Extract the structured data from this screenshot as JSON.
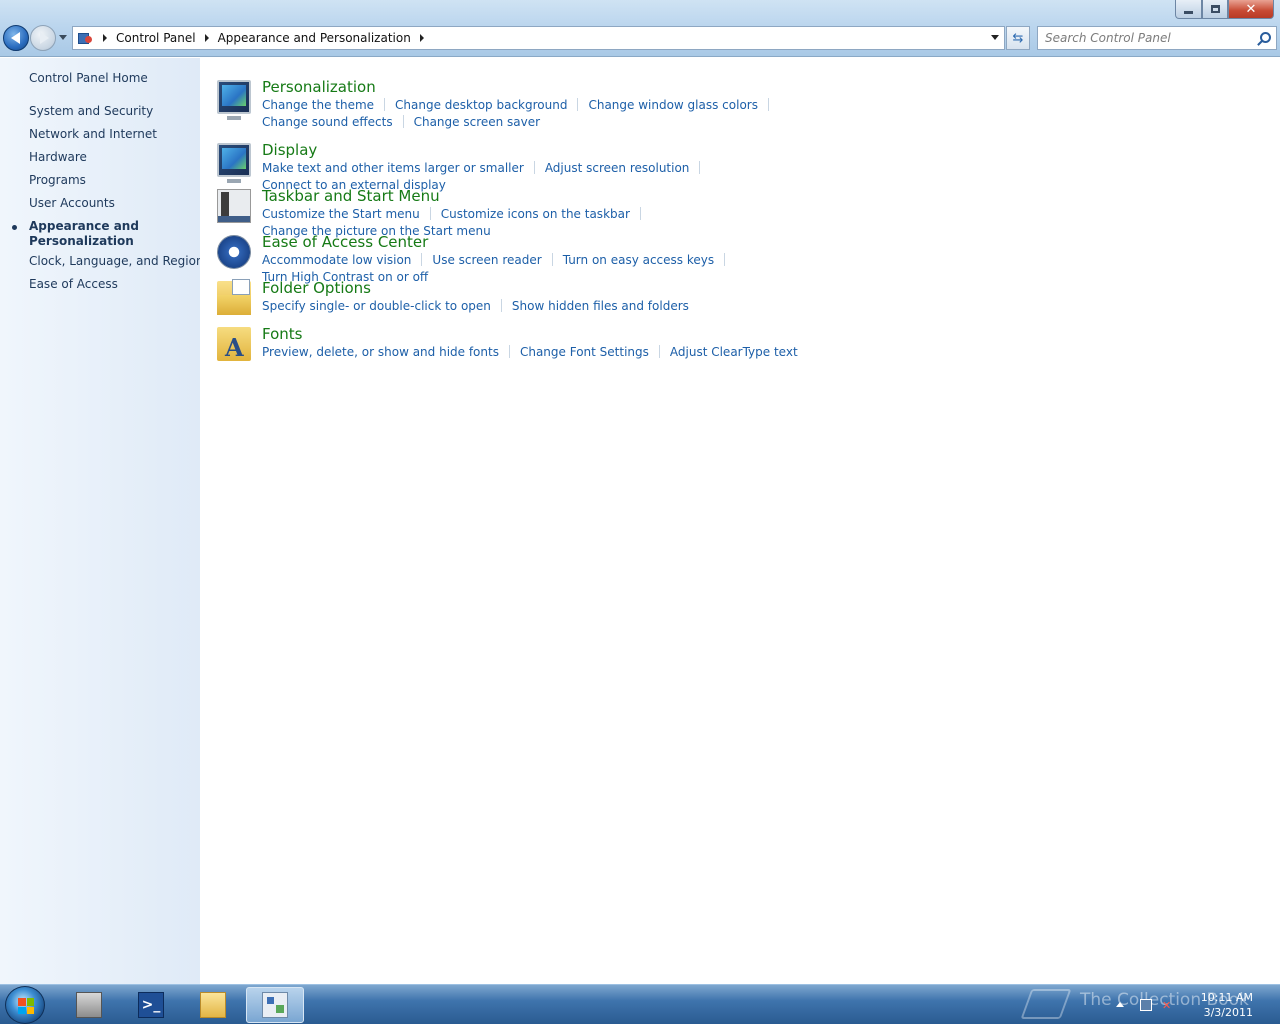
{
  "window": {
    "controls": {
      "minimize": "–",
      "maximize": "□",
      "close": "✕"
    }
  },
  "address": {
    "crumbs": [
      "Control Panel",
      "Appearance and Personalization"
    ]
  },
  "search": {
    "placeholder": "Search Control Panel",
    "value": ""
  },
  "sidebar": {
    "home": "Control Panel Home",
    "items": [
      {
        "label": "System and Security",
        "active": false
      },
      {
        "label": "Network and Internet",
        "active": false
      },
      {
        "label": "Hardware",
        "active": false
      },
      {
        "label": "Programs",
        "active": false
      },
      {
        "label": "User Accounts",
        "active": false
      },
      {
        "label": "Appearance and Personalization",
        "active": true
      },
      {
        "label": "Clock, Language, and Region",
        "active": false
      },
      {
        "label": "Ease of Access",
        "active": false
      }
    ]
  },
  "categories": [
    {
      "title": "Personalization",
      "icon": "personalization-icon",
      "links": [
        "Change the theme",
        "Change desktop background",
        "Change window glass colors",
        "Change sound effects",
        "Change screen saver"
      ]
    },
    {
      "title": "Display",
      "icon": "display-icon",
      "links": [
        "Make text and other items larger or smaller",
        "Adjust screen resolution",
        "Connect to an external display"
      ]
    },
    {
      "title": "Taskbar and Start Menu",
      "icon": "taskbar-start-menu-icon",
      "links": [
        "Customize the Start menu",
        "Customize icons on the taskbar",
        "Change the picture on the Start menu"
      ]
    },
    {
      "title": "Ease of Access Center",
      "icon": "ease-of-access-icon",
      "links": [
        "Accommodate low vision",
        "Use screen reader",
        "Turn on easy access keys",
        "Turn High Contrast on or off"
      ]
    },
    {
      "title": "Folder Options",
      "icon": "folder-options-icon",
      "links": [
        "Specify single- or double-click to open",
        "Show hidden files and folders"
      ]
    },
    {
      "title": "Fonts",
      "icon": "fonts-icon",
      "links": [
        "Preview, delete, or show and hide fonts",
        "Change Font Settings",
        "Adjust ClearType text"
      ]
    }
  ],
  "taskbar": {
    "apps": [
      {
        "name": "server-manager-icon",
        "label": ""
      },
      {
        "name": "powershell-icon",
        "label": ">_"
      },
      {
        "name": "windows-explorer-icon",
        "label": ""
      },
      {
        "name": "control-panel-icon",
        "label": "",
        "active": true
      }
    ],
    "watermark": "The Collection Book",
    "clock": {
      "time": "10:11 AM",
      "date": "3/3/2011"
    },
    "tray_volume": "✕"
  },
  "colors": {
    "link": "#1d5fa8",
    "category_title": "#167a16",
    "sidebar_text": "#1e395b"
  }
}
